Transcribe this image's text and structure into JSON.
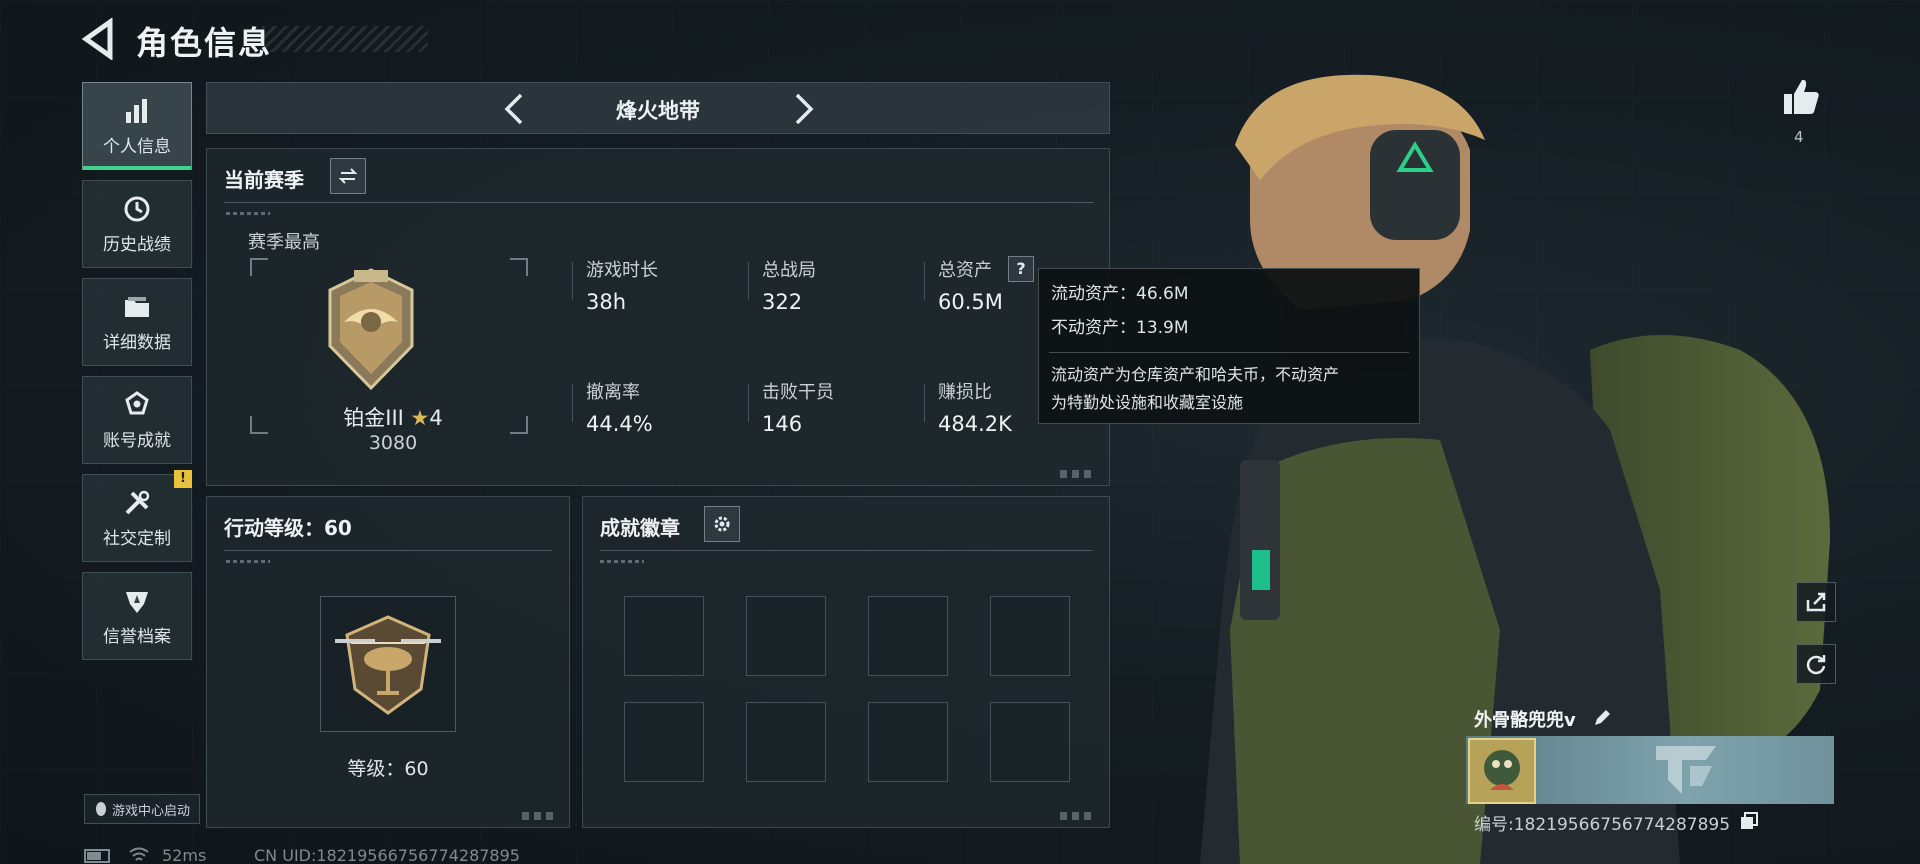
{
  "header": {
    "title": "角色信息"
  },
  "sidebar": {
    "items": [
      {
        "label": "个人信息",
        "icon": "bar-chart-icon",
        "active": true
      },
      {
        "label": "历史战绩",
        "icon": "clock-icon",
        "active": false
      },
      {
        "label": "详细数据",
        "icon": "folder-icon",
        "active": false
      },
      {
        "label": "账号成就",
        "icon": "medal-icon",
        "active": false
      },
      {
        "label": "社交定制",
        "icon": "tools-icon",
        "active": false,
        "badge": "!"
      },
      {
        "label": "信誉档案",
        "icon": "shield-icon",
        "active": false
      }
    ],
    "launch_label": "游戏中心启动"
  },
  "mode_tab": {
    "title": "烽火地带"
  },
  "season": {
    "title": "当前赛季",
    "best_label": "赛季最高",
    "rank_name": "铂金III",
    "rank_stars": "4",
    "rank_score": "3080",
    "stats": [
      {
        "label": "游戏时长",
        "value": "38h"
      },
      {
        "label": "总战局",
        "value": "322"
      },
      {
        "label": "总资产",
        "value": "60.5M",
        "help": "?"
      },
      {
        "label": "撤离率",
        "value": "44.4%"
      },
      {
        "label": "击败干员",
        "value": "146"
      },
      {
        "label": "赚损比",
        "value": "484.2K"
      }
    ]
  },
  "tooltip": {
    "line1": "流动资产：46.6M",
    "line2": "不动资产：13.9M",
    "desc1": "流动资产为仓库资产和哈夫币，不动资产",
    "desc2": "为特勤处设施和收藏室设施"
  },
  "action_level": {
    "title": "行动等级：60",
    "level_text": "等级：60"
  },
  "achievements": {
    "title": "成就徽章"
  },
  "profile": {
    "likes": "4",
    "name": "外骨骼兜兜v",
    "id_text": "编号:18219566756774287895"
  },
  "status_bar": {
    "ping": "52ms",
    "uid": "CN UID:18219566756774287895"
  },
  "colors": {
    "accent": "#3fd18d",
    "warning": "#e8c23a"
  }
}
